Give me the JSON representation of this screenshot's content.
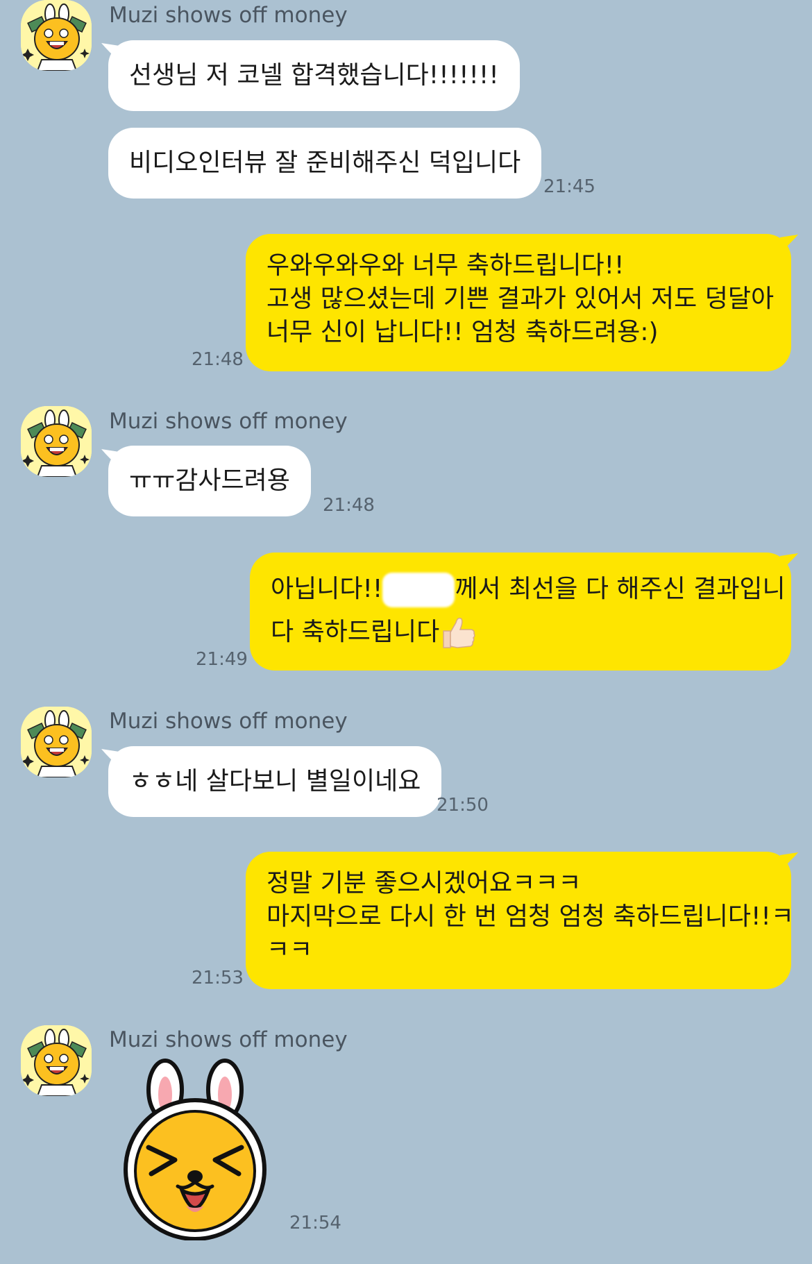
{
  "chat": {
    "sender_name": "Muzi shows off money",
    "messages": [
      {
        "side": "in",
        "text": "선생님 저 코넬 합격했습니다!!!!!!!"
      },
      {
        "side": "in",
        "text": "비디오인터뷰 잘 준비해주신 덕입니다",
        "time": "21:45"
      },
      {
        "side": "out",
        "lines": [
          "우와우와우와 너무 축하드립니다!!",
          "고생 많으셨는데 기쁜 결과가 있어서 저도 덩달아",
          "너무 신이 납니다!! 엄청 축하드려용:)"
        ],
        "time": "21:48"
      },
      {
        "side": "in",
        "text": "ㅠㅠ감사드려용",
        "time": "21:48"
      },
      {
        "side": "out",
        "line1_before": "아닙니다!!",
        "line1_after": "께서 최선을 다 해주신 결과입니",
        "line2": "다 축하드립니다",
        "time": "21:49"
      },
      {
        "side": "in",
        "text": "ㅎㅎ네 살다보니 별일이네요",
        "time": "21:50"
      },
      {
        "side": "out",
        "lines": [
          "정말 기분 좋으시겠어요ㅋㅋㅋ",
          "마지막으로 다시 한 번 엄청 엄청 축하드립니다!!ㅋ",
          "ㅋㅋ"
        ],
        "time": "21:53"
      },
      {
        "side": "in",
        "sticker": "muzi-squint-sticker",
        "time": "21:54"
      }
    ]
  },
  "icons": {
    "avatar": "muzi-money-avatar-icon",
    "thumbs_up": "thumbs-up-emoji-icon",
    "sticker": "muzi-squint-sticker"
  },
  "colors": {
    "background": "#abc1d1",
    "incoming_bubble": "#ffffff",
    "outgoing_bubble": "#fee500",
    "muzi_yellow": "#fcc020"
  }
}
